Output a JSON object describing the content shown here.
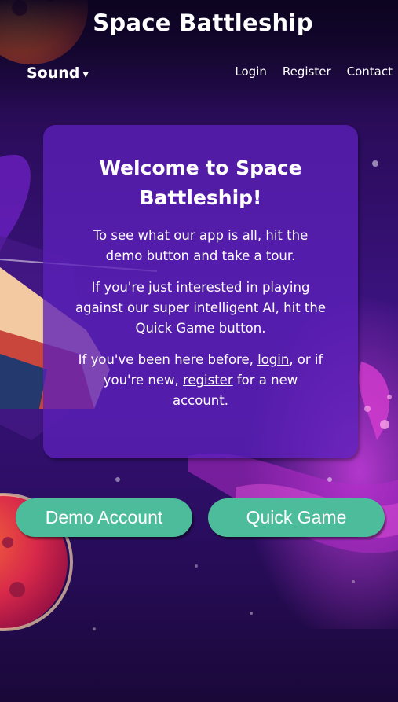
{
  "header": {
    "title": "Space Battleship",
    "sound_label": "Sound",
    "sound_caret": "▾",
    "nav": [
      "Login",
      "Register",
      "Contact"
    ]
  },
  "welcome": {
    "heading": "Welcome to Space Battleship!",
    "para1": "To see what our app is all, hit the demo button and take a tour.",
    "para2": "If you're just interested in playing against our super intelligent AI, hit the Quick Game button.",
    "para3_before": "If you've been here before, ",
    "para3_login": "login",
    "para3_middle": ", or if you're new, ",
    "para3_register": "register",
    "para3_after": " for a new account."
  },
  "buttons": {
    "demo": "Demo Account",
    "quick": "Quick Game"
  },
  "colors": {
    "accent_button": "#4dbc9b",
    "card": "#5c20ba",
    "background": "#1e0a3e"
  }
}
